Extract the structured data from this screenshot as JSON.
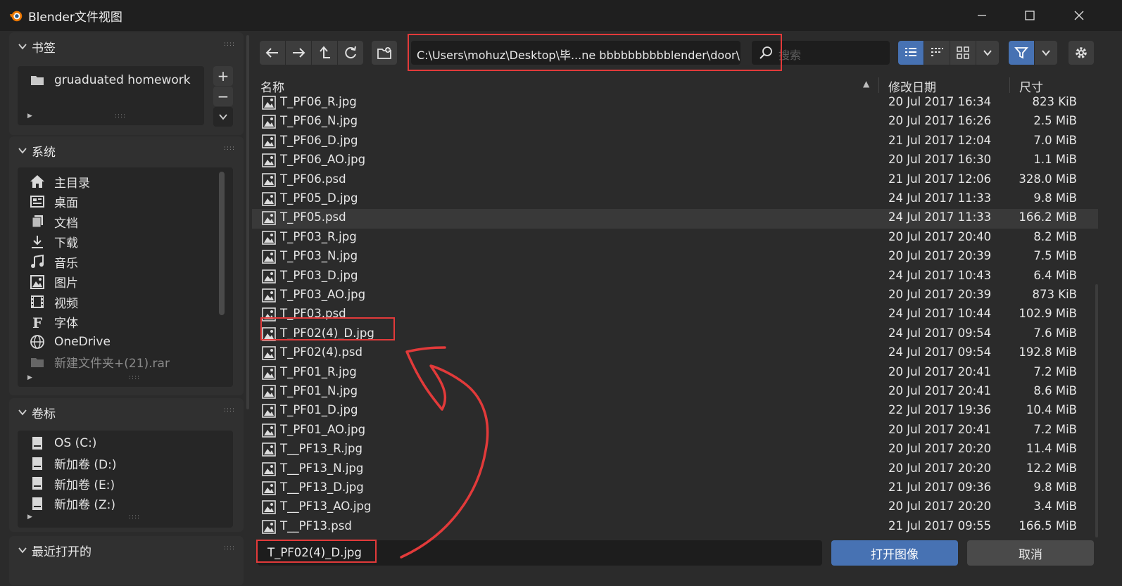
{
  "window": {
    "title": "Blender文件视图"
  },
  "sidebar": {
    "bookmarks": {
      "title": "书签",
      "items": [
        {
          "label": "gruaduated homework",
          "icon": "folder-icon"
        }
      ]
    },
    "system": {
      "title": "系统",
      "items": [
        {
          "label": "主目录",
          "icon": "home-icon"
        },
        {
          "label": "桌面",
          "icon": "desktop-icon"
        },
        {
          "label": "文档",
          "icon": "documents-icon"
        },
        {
          "label": "下载",
          "icon": "download-icon"
        },
        {
          "label": "音乐",
          "icon": "music-icon"
        },
        {
          "label": "图片",
          "icon": "image-icon"
        },
        {
          "label": "视频",
          "icon": "video-icon"
        },
        {
          "label": "字体",
          "icon": "font-icon"
        },
        {
          "label": "OneDrive",
          "icon": "globe-icon"
        },
        {
          "label": "新建文件夹+(21).rar",
          "icon": "folder-icon"
        }
      ]
    },
    "volumes": {
      "title": "卷标",
      "items": [
        {
          "label": "OS (C:)",
          "icon": "drive-icon"
        },
        {
          "label": "新加卷 (D:)",
          "icon": "drive-icon"
        },
        {
          "label": "新加卷 (E:)",
          "icon": "drive-icon"
        },
        {
          "label": "新加卷 (Z:)",
          "icon": "drive-icon"
        }
      ]
    },
    "recent": {
      "title": "最近打开的"
    }
  },
  "toolbar": {
    "path": "C:\\Users\\mohuz\\Desktop\\毕...ne bbbbbbbbbblender\\door\\",
    "search_placeholder": "搜索"
  },
  "table": {
    "headers": {
      "name": "名称",
      "date": "修改日期",
      "size": "尺寸"
    },
    "rows": [
      {
        "name": "T_PF06_R.jpg",
        "date": "20 Jul 2017 16:34",
        "size": "823 KiB"
      },
      {
        "name": "T_PF06_N.jpg",
        "date": "20 Jul 2017 16:26",
        "size": "2.5 MiB"
      },
      {
        "name": "T_PF06_D.jpg",
        "date": "21 Jul 2017 12:04",
        "size": "7.0 MiB"
      },
      {
        "name": "T_PF06_AO.jpg",
        "date": "20 Jul 2017 16:30",
        "size": "1.1 MiB"
      },
      {
        "name": "T_PF06.psd",
        "date": "21 Jul 2017 12:06",
        "size": "328.0 MiB"
      },
      {
        "name": "T_PF05_D.jpg",
        "date": "24 Jul 2017 11:33",
        "size": "9.8 MiB"
      },
      {
        "name": "T_PF05.psd",
        "date": "24 Jul 2017 11:33",
        "size": "166.2 MiB"
      },
      {
        "name": "T_PF03_R.jpg",
        "date": "20 Jul 2017 20:40",
        "size": "8.2 MiB"
      },
      {
        "name": "T_PF03_N.jpg",
        "date": "20 Jul 2017 20:39",
        "size": "7.5 MiB"
      },
      {
        "name": "T_PF03_D.jpg",
        "date": "24 Jul 2017 10:43",
        "size": "6.4 MiB"
      },
      {
        "name": "T_PF03_AO.jpg",
        "date": "20 Jul 2017 20:39",
        "size": "873 KiB"
      },
      {
        "name": "T_PF03.psd",
        "date": "24 Jul 2017 10:44",
        "size": "102.9 MiB"
      },
      {
        "name": "T_PF02(4)_D.jpg",
        "date": "24 Jul 2017 09:54",
        "size": "7.6 MiB"
      },
      {
        "name": "T_PF02(4).psd",
        "date": "24 Jul 2017 09:54",
        "size": "192.8 MiB"
      },
      {
        "name": "T_PF01_R.jpg",
        "date": "20 Jul 2017 20:41",
        "size": "7.2 MiB"
      },
      {
        "name": "T_PF01_N.jpg",
        "date": "20 Jul 2017 20:41",
        "size": "8.6 MiB"
      },
      {
        "name": "T_PF01_D.jpg",
        "date": "22 Jul 2017 19:36",
        "size": "10.4 MiB"
      },
      {
        "name": "T_PF01_AO.jpg",
        "date": "20 Jul 2017 20:41",
        "size": "7.2 MiB"
      },
      {
        "name": "T__PF13_R.jpg",
        "date": "20 Jul 2017 20:20",
        "size": "11.4 MiB"
      },
      {
        "name": "T__PF13_N.jpg",
        "date": "20 Jul 2017 20:20",
        "size": "12.2 MiB"
      },
      {
        "name": "T__PF13_D.jpg",
        "date": "21 Jul 2017 09:36",
        "size": "9.8 MiB"
      },
      {
        "name": "T__PF13_AO.jpg",
        "date": "20 Jul 2017 20:20",
        "size": "3.4 MiB"
      },
      {
        "name": "T__PF13.psd",
        "date": "21 Jul 2017 09:55",
        "size": "166.5 MiB"
      }
    ]
  },
  "footer": {
    "filename": "T_PF02(4)_D.jpg",
    "open_label": "打开图像",
    "cancel_label": "取消"
  },
  "colors": {
    "accent": "#4772b3",
    "annotation": "#e23a3a"
  }
}
